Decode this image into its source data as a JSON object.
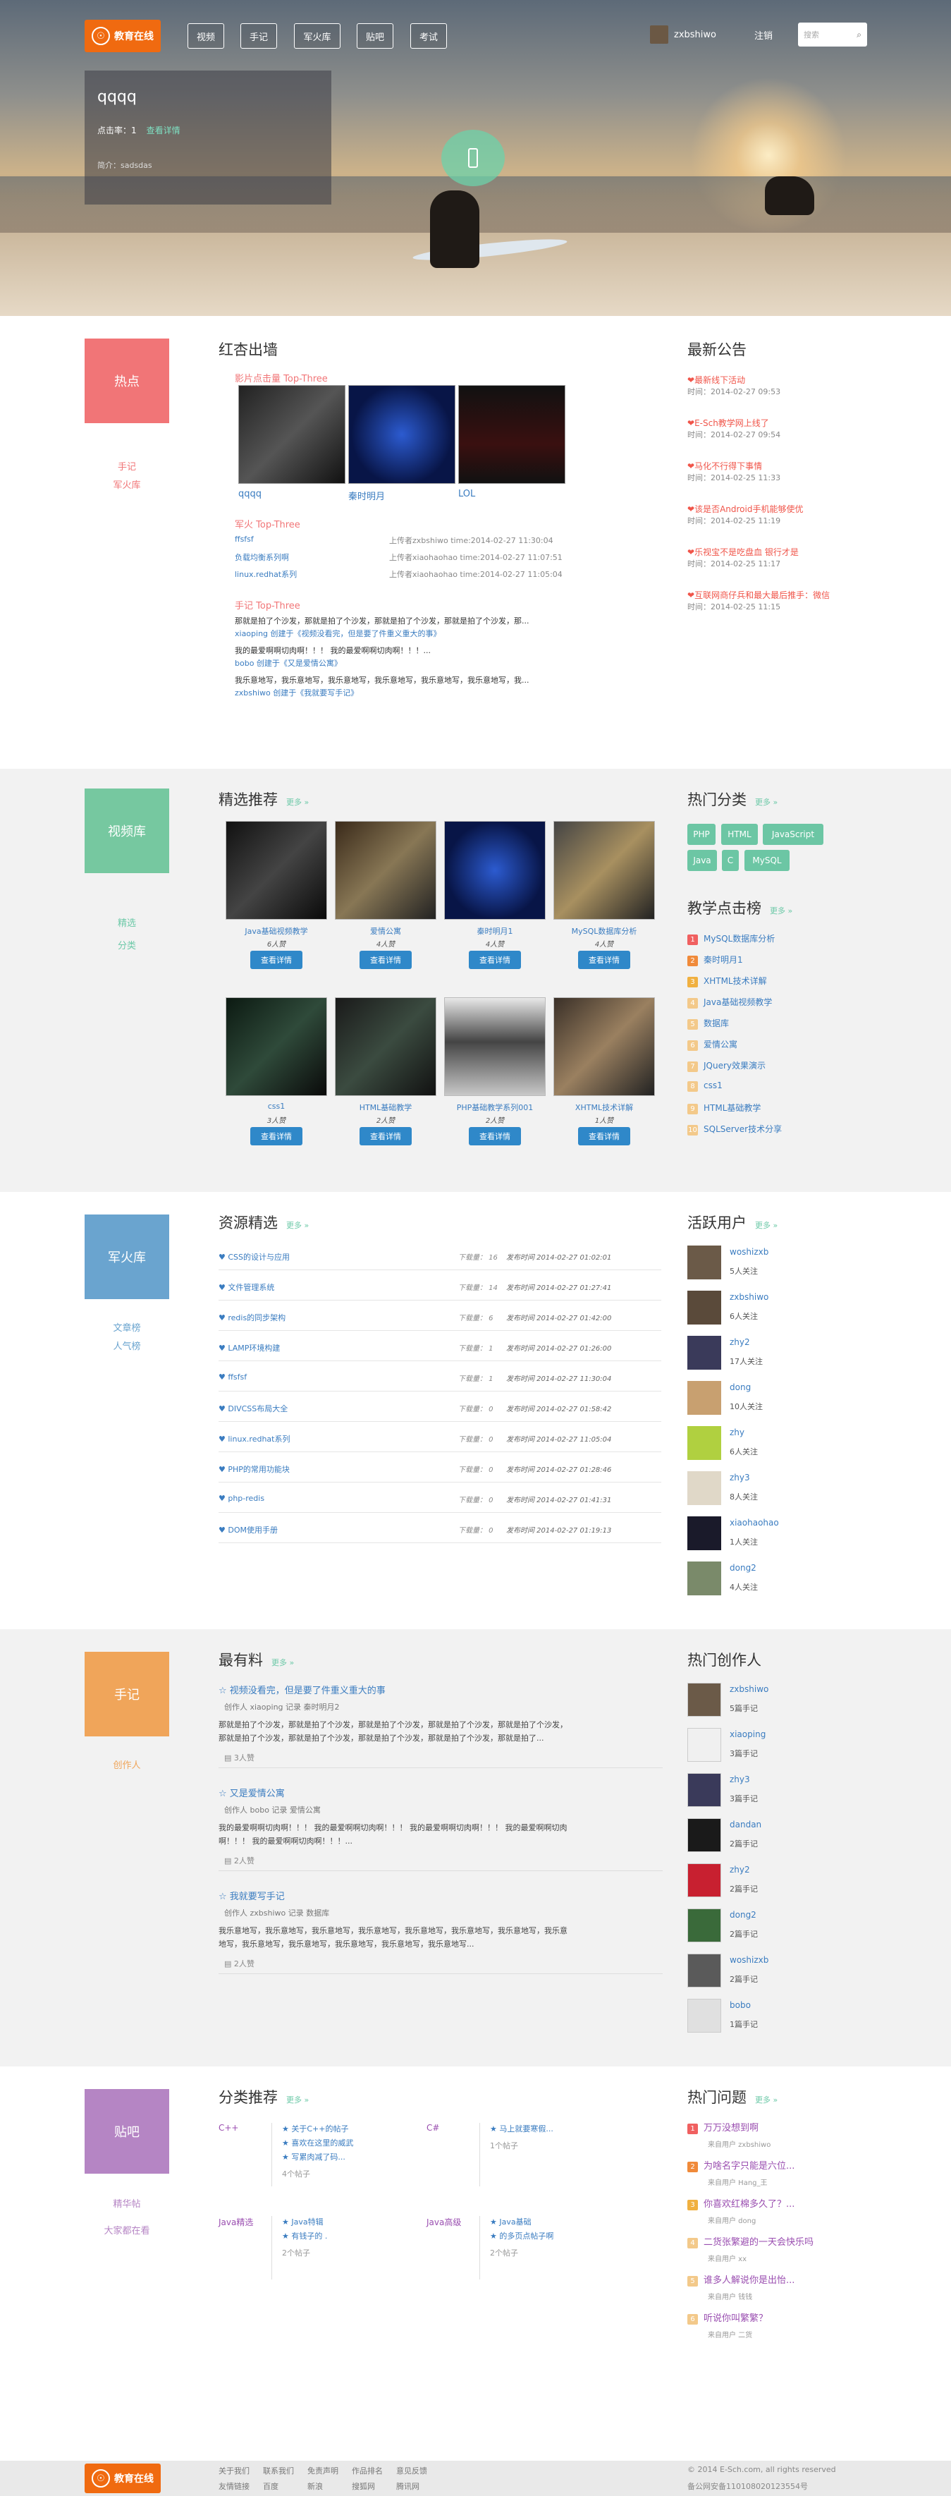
{
  "nav": {
    "logo": "教育在线",
    "items": [
      "视频",
      "手记",
      "军火库",
      "贴吧",
      "考试"
    ],
    "user": "zxbshiwo",
    "logout": "注销",
    "search_placeholder": "搜索"
  },
  "hero": {
    "title": "qqqq",
    "click_label": "点击率：",
    "click_value": "1",
    "detail": "查看详情",
    "intro": "简介：sadsdas"
  },
  "s1": {
    "tile": "热点",
    "links": [
      "手记",
      "军火库"
    ],
    "title": "红杏出墙",
    "video_head": "影片点击量 Top-Three",
    "videos": [
      "qqqq",
      "秦时明月",
      "LOL"
    ],
    "arsenal_head": "军火 Top-Three",
    "arsenal": [
      {
        "name": "ffsfsf",
        "meta": "上传者zxbshiwo time:2014-02-27 11:30:04"
      },
      {
        "name": "负载均衡系列啊",
        "meta": "上传者xiaohaohao time:2014-02-27 11:07:51"
      },
      {
        "name": "linux.redhat系列",
        "meta": "上传者xiaohaohao time:2014-02-27 11:05:04"
      }
    ],
    "notes_head": "手记 Top-Three",
    "notes": [
      {
        "text": "那就是拍了个沙发，那就是拍了个沙发，那就是拍了个沙发，那就是拍了个沙发，那...",
        "by": "xiaoping 创建于《视频没看完，但是要了件重义重大的事》"
      },
      {
        "text": "我的最爱啊啊切肉啊！！！ 我的最爱啊啊切肉啊！！！...",
        "by": "bobo 创建于《又是爱情公寓》"
      },
      {
        "text": "我乐意地写，我乐意地写，我乐意地写，我乐意地写，我乐意地写，我乐意地写，我...",
        "by": "zxbshiwo 创建于《我就要写手记》"
      }
    ],
    "announce_title": "最新公告",
    "announces": [
      {
        "t": "最新线下活动",
        "d": "时间：2014-02-27 09:53"
      },
      {
        "t": "E-Sch教学网上线了",
        "d": "时间：2014-02-27 09:54"
      },
      {
        "t": "马化不行得下事情",
        "d": "时间：2014-02-25 11:33"
      },
      {
        "t": "该是否Android手机能够使优",
        "d": "时间：2014-02-25 11:19"
      },
      {
        "t": "乐视宝不是吃盘血 银行才是",
        "d": "时间：2014-02-25 11:17"
      },
      {
        "t": "互联网商仔兵和最大最后推手：微信",
        "d": "时间：2014-02-25 11:15"
      }
    ]
  },
  "s2": {
    "tile": "视频库",
    "links": [
      "精选",
      "分类"
    ],
    "title": "精选推荐",
    "more": "更多 »",
    "videos": [
      {
        "t": "Java基础视频教学",
        "c": "6人赞"
      },
      {
        "t": "爱情公寓",
        "c": "4人赞"
      },
      {
        "t": "秦时明月1",
        "c": "4人赞"
      },
      {
        "t": "MySQL数据库分析",
        "c": "4人赞"
      },
      {
        "t": "css1",
        "c": "3人赞"
      },
      {
        "t": "HTML基础教学",
        "c": "2人赞"
      },
      {
        "t": "PHP基础教学系列001",
        "c": "2人赞"
      },
      {
        "t": "XHTML技术详解",
        "c": "1人赞"
      }
    ],
    "btn": "查看详情",
    "cat_title": "热门分类",
    "cats": [
      "PHP",
      "HTML",
      "JavaScript",
      "Java",
      "C",
      "MySQL"
    ],
    "rank_title": "教学点击榜",
    "rank": [
      "MySQL数据库分析",
      "秦时明月1",
      "XHTML技术详解",
      "Java基础视频教学",
      "数据库",
      "爱情公寓",
      "JQuery效果演示",
      "css1",
      "HTML基础教学",
      "SQLServer技术分享"
    ]
  },
  "s3": {
    "tile": "军火库",
    "links": [
      "文章榜",
      "人气榜"
    ],
    "title": "资源精选",
    "more": "更多 »",
    "rows": [
      {
        "n": "CSS的设计与应用",
        "d": "16",
        "t": "2014-02-27 01:02:01"
      },
      {
        "n": "文件管理系统",
        "d": "14",
        "t": "2014-02-27 01:27:41"
      },
      {
        "n": "redis的同步架构",
        "d": "6",
        "t": "2014-02-27 01:42:00"
      },
      {
        "n": "LAMP环境构建",
        "d": "1",
        "t": "2014-02-27 01:26:00"
      },
      {
        "n": "ffsfsf",
        "d": "1",
        "t": "2014-02-27 11:30:04"
      },
      {
        "n": "DIVCSS布局大全",
        "d": "0",
        "t": "2014-02-27 01:58:42"
      },
      {
        "n": "linux.redhat系列",
        "d": "0",
        "t": "2014-02-27 11:05:04"
      },
      {
        "n": "PHP的常用功能块",
        "d": "0",
        "t": "2014-02-27 01:28:46"
      },
      {
        "n": "php-redis",
        "d": "0",
        "t": "2014-02-27 01:41:31"
      },
      {
        "n": "DOM使用手册",
        "d": "0",
        "t": "2014-02-27 01:19:13"
      }
    ],
    "dl_label": "下载量：",
    "time_label": "发布时间",
    "users_title": "活跃用户",
    "users": [
      {
        "n": "woshizxb",
        "c": "5人关注"
      },
      {
        "n": "zxbshiwo",
        "c": "6人关注"
      },
      {
        "n": "zhy2",
        "c": "17人关注"
      },
      {
        "n": "dong",
        "c": "10人关注"
      },
      {
        "n": "zhy",
        "c": "6人关注"
      },
      {
        "n": "zhy3",
        "c": "8人关注"
      },
      {
        "n": "xiaohaohao",
        "c": "1人关注"
      },
      {
        "n": "dong2",
        "c": "4人关注"
      }
    ]
  },
  "s4": {
    "tile": "手记",
    "links": [
      "创作人"
    ],
    "title": "最有料",
    "more": "更多 »",
    "posts": [
      {
        "t": "视频没看完，但是要了件重义重大的事",
        "meta": "创作人 xiaoping 记录 秦时明月2",
        "body": "那就是拍了个沙发，那就是拍了个沙发，那就是拍了个沙发，那就是拍了个沙发，那就是拍了个沙发，那就是拍了个沙发，那就是拍了个沙发，那就是拍了个沙发，那就是拍了个沙发，那就是拍了...",
        "c": "3人赞"
      },
      {
        "t": "又是爱情公寓",
        "meta": "创作人 bobo 记录 爱情公寓",
        "body": "我的最爱啊啊切肉啊！！！ 我的最爱啊啊切肉啊！！！ 我的最爱啊啊切肉啊！！！ 我的最爱啊啊切肉啊！！！ 我的最爱啊啊切肉啊！！！...",
        "c": "2人赞"
      },
      {
        "t": "我就要写手记",
        "meta": "创作人 zxbshiwo 记录 数据库",
        "body": "我乐意地写，我乐意地写，我乐意地写，我乐意地写，我乐意地写，我乐意地写，我乐意地写，我乐意地写，我乐意地写，我乐意地写，我乐意地写，我乐意地写，我乐意地写...",
        "c": "2人赞"
      }
    ],
    "creators_title": "热门创作人",
    "creators": [
      {
        "n": "zxbshiwo",
        "c": "5篇手记"
      },
      {
        "n": "xiaoping",
        "c": "3篇手记"
      },
      {
        "n": "zhy3",
        "c": "3篇手记"
      },
      {
        "n": "dandan",
        "c": "2篇手记"
      },
      {
        "n": "zhy2",
        "c": "2篇手记"
      },
      {
        "n": "dong2",
        "c": "2篇手记"
      },
      {
        "n": "woshizxb",
        "c": "2篇手记"
      },
      {
        "n": "bobo",
        "c": "1篇手记"
      }
    ]
  },
  "s5": {
    "tile": "贴吧",
    "links": [
      "精华帖",
      "大家都在看"
    ],
    "title": "分类推荐",
    "more": "更多 »",
    "cats": [
      {
        "n": "C++",
        "items": [
          "关于C++的帖子",
          "喜欢在这里的威武",
          "写累肉减了码..."
        ],
        "c": "4个帖子"
      },
      {
        "n": "C#",
        "items": [
          "马上就要寒假..."
        ],
        "c": "1个帖子"
      },
      {
        "n": "Java精选",
        "items": [
          "Java特辑",
          "有钱子的 ."
        ],
        "c": "2个帖子"
      },
      {
        "n": "Java高级",
        "items": [
          "Java基础",
          "的多页点帖子啊"
        ],
        "c": "2个帖子"
      }
    ],
    "hot_title": "热门问题",
    "hot": [
      {
        "t": "万万没想到啊",
        "m": "来自用户 zxbshiwo"
      },
      {
        "t": "为啥名字只能是六位...",
        "m": "来自用户 Hang_王"
      },
      {
        "t": "你喜欢红棉多久了？...",
        "m": "来自用户 dong"
      },
      {
        "t": "二货张繁避的一天会快乐吗",
        "m": "来自用户 xx"
      },
      {
        "t": "谁多人解说你是出怡...",
        "m": "来自用户 钱钱"
      },
      {
        "t": "听说你叫繁繁？",
        "m": "来自用户 二货"
      }
    ]
  },
  "footer": {
    "logo": "教育在线",
    "links1": [
      "关于我们",
      "联系我们",
      "免责声明",
      "作品排名",
      "意见反馈"
    ],
    "links2": [
      "友情链接",
      "百度",
      "新浪",
      "搜狐网",
      "腾讯网"
    ],
    "copy": "© 2014 E-Sch.com, all rights reserved",
    "icp": "备公网安备110108020123554号"
  },
  "colors": {
    "orange": "#f06a10",
    "hot": "#f17577",
    "video": "#76c8a0",
    "arsenal": "#6aa4cf",
    "notes": "#f0a55a",
    "tieba": "#b585c4",
    "tag": "#6cc6a4",
    "btn": "#2f88c9"
  }
}
